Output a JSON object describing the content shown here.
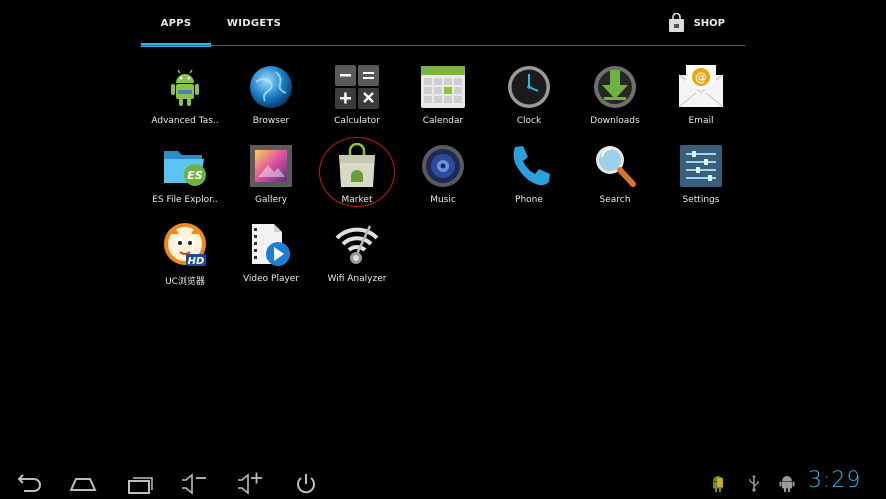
{
  "tabs": {
    "apps": "APPS",
    "widgets": "WIDGETS",
    "shop": "SHOP"
  },
  "apps": [
    {
      "label": "Advanced Tas..",
      "icon": "android-robot-icon"
    },
    {
      "label": "Browser",
      "icon": "globe-icon"
    },
    {
      "label": "Calculator",
      "icon": "calculator-icon"
    },
    {
      "label": "Calendar",
      "icon": "calendar-icon"
    },
    {
      "label": "Clock",
      "icon": "clock-icon"
    },
    {
      "label": "Downloads",
      "icon": "download-icon"
    },
    {
      "label": "Email",
      "icon": "email-icon"
    },
    {
      "label": "ES File Explor..",
      "icon": "folder-icon"
    },
    {
      "label": "Gallery",
      "icon": "gallery-icon"
    },
    {
      "label": "Market",
      "icon": "market-bag-icon"
    },
    {
      "label": "Music",
      "icon": "speaker-icon"
    },
    {
      "label": "Phone",
      "icon": "phone-icon"
    },
    {
      "label": "Search",
      "icon": "magnifier-icon"
    },
    {
      "label": "Settings",
      "icon": "settings-sliders-icon"
    },
    {
      "label": "UC浏览器",
      "icon": "uc-squirrel-icon"
    },
    {
      "label": "Video Player",
      "icon": "video-player-icon"
    },
    {
      "label": "Wifi Analyzer",
      "icon": "wifi-icon"
    }
  ],
  "system_bar": {
    "time": "3:29",
    "buttons": [
      "back-icon",
      "home-icon",
      "recent-apps-icon",
      "volume-down-icon",
      "volume-up-icon",
      "power-icon"
    ],
    "status_icons": [
      "android-notification-icon",
      "usb-icon",
      "android-debug-icon"
    ]
  },
  "colors": {
    "accent": "#34b5e5",
    "highlight_circle": "#c51414"
  }
}
